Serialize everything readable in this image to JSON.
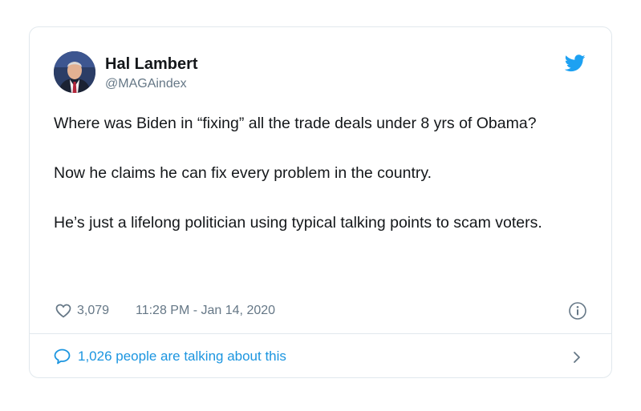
{
  "tweet": {
    "author": {
      "display_name": "Hal Lambert",
      "handle": "@MAGAindex"
    },
    "paragraphs": [
      "Where was Biden in “fixing” all the trade deals under 8 yrs of Obama?",
      "Now he claims he can fix every problem in the country.",
      "He’s just a lifelong politician using typical talking points to scam voters."
    ],
    "likes": "3,079",
    "timestamp": "11:28 PM - Jan 14, 2020",
    "talking": "1,026 people are talking about this"
  },
  "icons": {
    "bird": "twitter-bird-icon",
    "heart": "heart-icon",
    "info": "info-icon",
    "bubble": "speech-bubble-icon",
    "chevron": "chevron-right-icon"
  },
  "colors": {
    "twitter_blue": "#1da1f2",
    "link_blue": "#1b95e0",
    "muted": "#657786",
    "text": "#14171a",
    "border": "#e1e8ed"
  }
}
